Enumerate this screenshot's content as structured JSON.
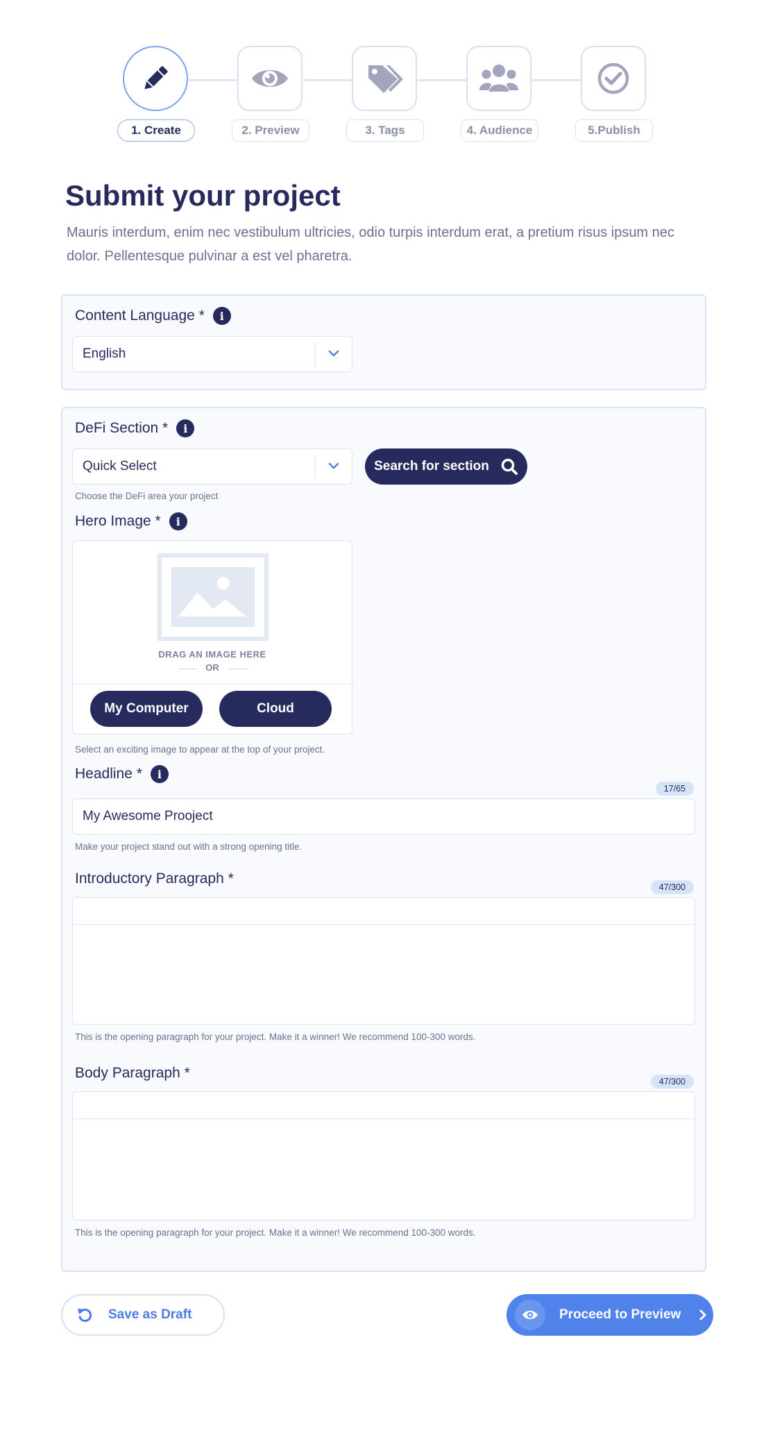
{
  "stepper": {
    "steps": [
      {
        "label": "1. Create",
        "icon": "pencil-icon",
        "active": true
      },
      {
        "label": "2. Preview",
        "icon": "eye-icon",
        "active": false
      },
      {
        "label": "3. Tags",
        "icon": "tags-icon",
        "active": false
      },
      {
        "label": "4. Audience",
        "icon": "users-icon",
        "active": false
      },
      {
        "label": "5.Publish",
        "icon": "check-circle-icon",
        "active": false
      }
    ]
  },
  "header": {
    "title": "Submit your project",
    "description": "Mauris interdum, enim nec vestibulum ultricies, odio turpis interdum erat, a pretium risus ipsum nec dolor. Pellentesque pulvinar a est vel pharetra."
  },
  "language": {
    "label": "Content Language *",
    "value": "English"
  },
  "defi": {
    "label": "DeFi Section *",
    "select_value": "Quick Select",
    "search_button": "Search for section",
    "hint": "Choose the DeFi area your project"
  },
  "hero": {
    "label": "Hero Image *",
    "drag_text": "DRAG AN IMAGE HERE",
    "or_text": "OR",
    "computer_button": "My Computer",
    "cloud_button": "Cloud",
    "hint": "Select an exciting image to appear at the top of your project."
  },
  "headline": {
    "label": "Headline *",
    "counter": "17/65",
    "value": "My Awesome Prooject",
    "hint": "Make your project  stand out with a strong opening title."
  },
  "intro": {
    "label": "Introductory Paragraph *",
    "counter": "47/300",
    "hint": "This is the opening paragraph for your project. Make it a winner! We recommend 100-300 words."
  },
  "body_paragraph": {
    "label": "Body Paragraph *",
    "counter": "47/300",
    "hint": "This is the opening paragraph for your project. Make it a winner! We recommend 100-300 words."
  },
  "footer": {
    "draft_label": "Save as Draft",
    "proceed_label": "Proceed to Preview"
  },
  "colors": {
    "navy": "#262a5c",
    "accent": "#4f82ea",
    "border": "#d6e3f5"
  }
}
